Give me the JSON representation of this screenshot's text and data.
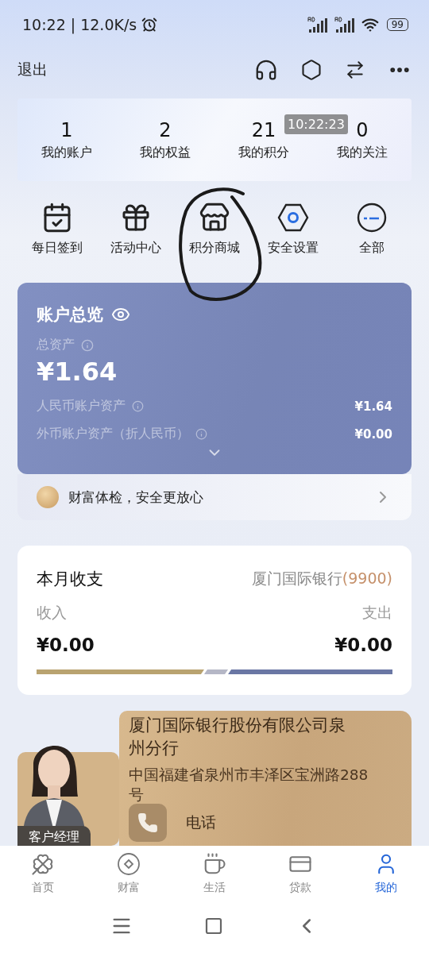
{
  "status_bar": {
    "time": "10:22",
    "divider": "|",
    "speed": "12.0K/s",
    "battery": "99"
  },
  "header": {
    "exit": "退出"
  },
  "stats": [
    {
      "value": "1",
      "label": "我的账户"
    },
    {
      "value": "2",
      "label": "我的权益"
    },
    {
      "value": "21",
      "label": "我的积分"
    },
    {
      "value": "0",
      "label": "我的关注"
    }
  ],
  "timestamp_overlay": "10:22:23",
  "shortcuts": [
    {
      "kind": "calendar",
      "label": "每日签到"
    },
    {
      "kind": "gift",
      "label": "活动中心"
    },
    {
      "kind": "store",
      "label": "积分商城"
    },
    {
      "kind": "security",
      "label": "安全设置"
    },
    {
      "kind": "all",
      "label": "全部"
    }
  ],
  "overview": {
    "title": "账户总览",
    "total_label": "总资产",
    "total": "¥1.64",
    "rows": [
      {
        "label": "人民币账户资产",
        "value": "¥1.64"
      },
      {
        "label": "外币账户资产（折人民币）",
        "value": "¥0.00"
      }
    ]
  },
  "wealth_check": {
    "text": "财富体检，安全更放心"
  },
  "monthly": {
    "title": "本月收支",
    "bank": "厦门国际银行",
    "account": "(9900)",
    "income_label": "收入",
    "income": "¥0.00",
    "expense_label": "支出",
    "expense": "¥0.00"
  },
  "manager": {
    "badge": "客户经理",
    "branch": "厦门国际银行股份有限公司泉州分行",
    "address": "中国福建省泉州市丰泽区宝洲路288号",
    "phone": "电话"
  },
  "tabs": [
    {
      "kind": "home",
      "label": "首页",
      "selected": false
    },
    {
      "kind": "wealth",
      "label": "财富",
      "selected": false
    },
    {
      "kind": "life",
      "label": "生活",
      "selected": false
    },
    {
      "kind": "loan",
      "label": "贷款",
      "selected": false
    },
    {
      "kind": "me",
      "label": "我的",
      "selected": true
    }
  ]
}
